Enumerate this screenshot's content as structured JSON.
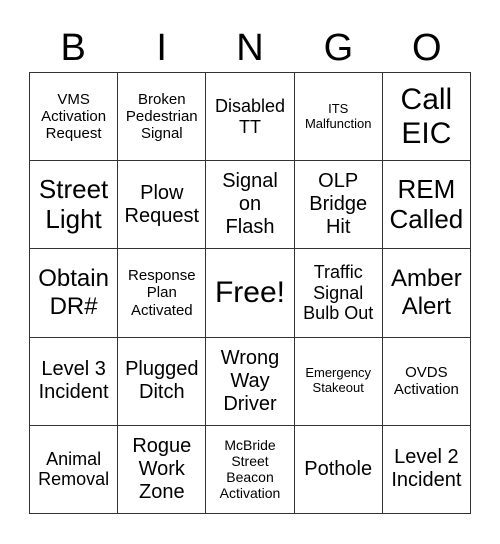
{
  "header": [
    "B",
    "I",
    "N",
    "G",
    "O"
  ],
  "cells": [
    "VMS Activation Request",
    "Broken Pedestrian Signal",
    "Disabled TT",
    "ITS Malfunction",
    "Call EIC",
    "Street Light",
    "Plow Request",
    "Signal on Flash",
    "OLP Bridge Hit",
    "REM Called",
    "Obtain DR#",
    "Response Plan Activated",
    "Free!",
    "Traffic Signal Bulb Out",
    "Amber Alert",
    "Level 3 Incident",
    "Plugged Ditch",
    "Wrong Way Driver",
    "Emergency Stakeout",
    "OVDS Activation",
    "Animal Removal",
    "Rogue Work Zone",
    "McBride Street Beacon Activation",
    "Pothole",
    "Level 2 Incident"
  ]
}
